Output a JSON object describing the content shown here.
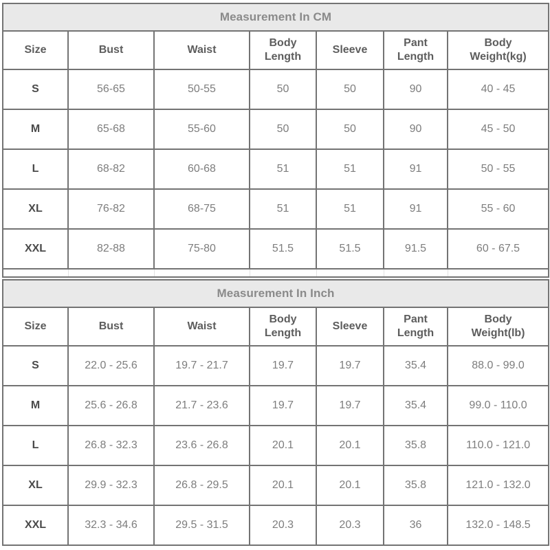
{
  "document": {
    "type": "size-chart",
    "colors": {
      "border": "#737373",
      "title_background": "#e9e9e9",
      "title_text": "#8a8a8a",
      "header_text": "#5d5d5d",
      "size_text": "#4a4a4a",
      "value_text": "#7d7d7d",
      "cell_background": "#ffffff"
    }
  },
  "tables": [
    {
      "title": "Measurement In CM",
      "headers": [
        "Size",
        "Bust",
        "Waist",
        "Body Length",
        "Sleeve",
        "Pant Length",
        "Body Weight(kg)"
      ],
      "headers_wrapped": [
        [
          "Size"
        ],
        [
          "Bust"
        ],
        [
          "Waist"
        ],
        [
          "Body",
          "Length"
        ],
        [
          "Sleeve"
        ],
        [
          "Pant",
          "Length"
        ],
        [
          "Body",
          "Weight(kg)"
        ]
      ],
      "rows": [
        [
          "S",
          "56-65",
          "50-55",
          "50",
          "50",
          "90",
          "40 - 45"
        ],
        [
          "M",
          "65-68",
          "55-60",
          "50",
          "50",
          "90",
          "45 - 50"
        ],
        [
          "L",
          "68-82",
          "60-68",
          "51",
          "51",
          "91",
          "50 - 55"
        ],
        [
          "XL",
          "76-82",
          "68-75",
          "51",
          "51",
          "91",
          "55 - 60"
        ],
        [
          "XXL",
          "82-88",
          "75-80",
          "51.5",
          "51.5",
          "91.5",
          "60 - 67.5"
        ]
      ]
    },
    {
      "title": "Measurement In Inch",
      "headers": [
        "Size",
        "Bust",
        "Waist",
        "Body Length",
        "Sleeve",
        "Pant Length",
        "Body Weight(lb)"
      ],
      "headers_wrapped": [
        [
          "Size"
        ],
        [
          "Bust"
        ],
        [
          "Waist"
        ],
        [
          "Body",
          "Length"
        ],
        [
          "Sleeve"
        ],
        [
          "Pant",
          "Length"
        ],
        [
          "Body",
          "Weight(lb)"
        ]
      ],
      "rows": [
        [
          "S",
          "22.0 - 25.6",
          "19.7 - 21.7",
          "19.7",
          "19.7",
          "35.4",
          "88.0 - 99.0"
        ],
        [
          "M",
          "25.6 - 26.8",
          "21.7 - 23.6",
          "19.7",
          "19.7",
          "35.4",
          "99.0 - 110.0"
        ],
        [
          "L",
          "26.8 - 32.3",
          "23.6 - 26.8",
          "20.1",
          "20.1",
          "35.8",
          "110.0 - 121.0"
        ],
        [
          "XL",
          "29.9 - 32.3",
          "26.8 - 29.5",
          "20.1",
          "20.1",
          "35.8",
          "121.0 - 132.0"
        ],
        [
          "XXL",
          "32.3 - 34.6",
          "29.5 - 31.5",
          "20.3",
          "20.3",
          "36",
          "132.0 - 148.5"
        ]
      ]
    }
  ]
}
